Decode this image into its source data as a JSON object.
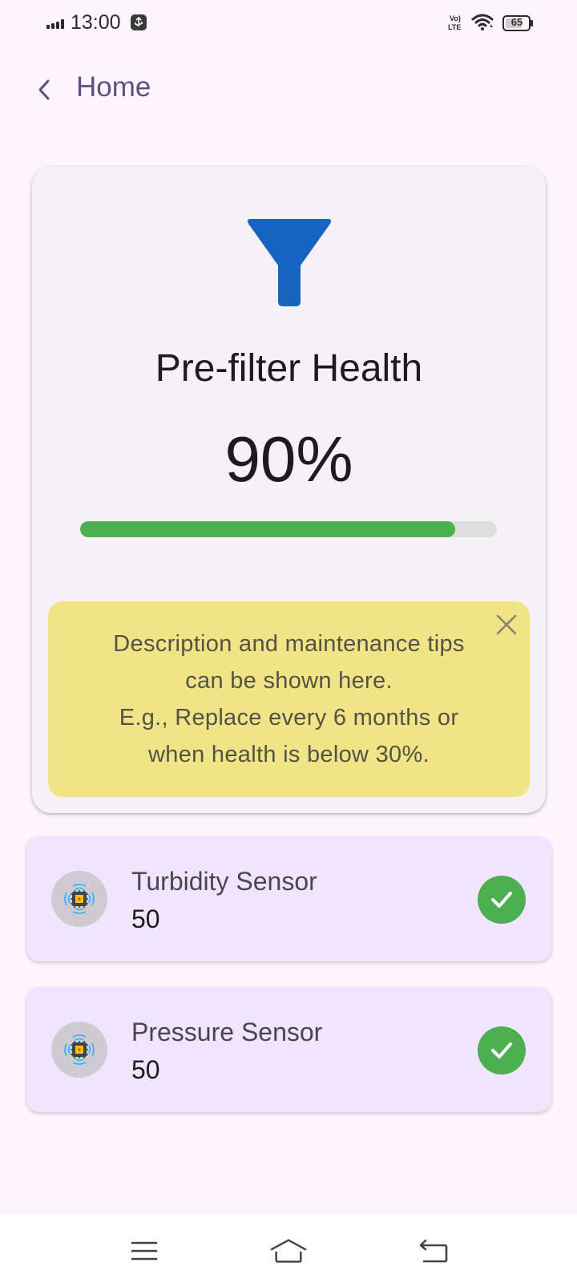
{
  "status_bar": {
    "time": "13:00",
    "battery": "65",
    "icons": [
      "signal-icon",
      "usb-icon",
      "volte-icon",
      "wifi-icon",
      "battery-icon"
    ]
  },
  "app_bar": {
    "back_icon": "chevron-left-icon",
    "title": "Home"
  },
  "filter_card": {
    "icon": "filter-funnel-icon",
    "title": "Pre-filter Health",
    "value_text": "90%",
    "progress_fraction": 0.9,
    "colors": {
      "icon": "#1565c0",
      "progress": "#4caf50",
      "track": "#dedede"
    },
    "tips": {
      "lines": [
        "Description and maintenance tips",
        "can be shown here.",
        "E.g., Replace every 6 months or",
        "when health is below 30%."
      ],
      "close_icon": "close-icon",
      "background": "#f0e486"
    }
  },
  "sensors": [
    {
      "name": "Turbidity Sensor",
      "value": "50",
      "icon": "sensor-chip-icon",
      "status_icon": "check-circle-icon",
      "status_color": "#4caf50"
    },
    {
      "name": "Pressure Sensor",
      "value": "50",
      "icon": "sensor-chip-icon",
      "status_icon": "check-circle-icon",
      "status_color": "#4caf50"
    }
  ],
  "nav_bar": {
    "items": [
      "menu-icon",
      "home-icon",
      "back-icon"
    ]
  }
}
